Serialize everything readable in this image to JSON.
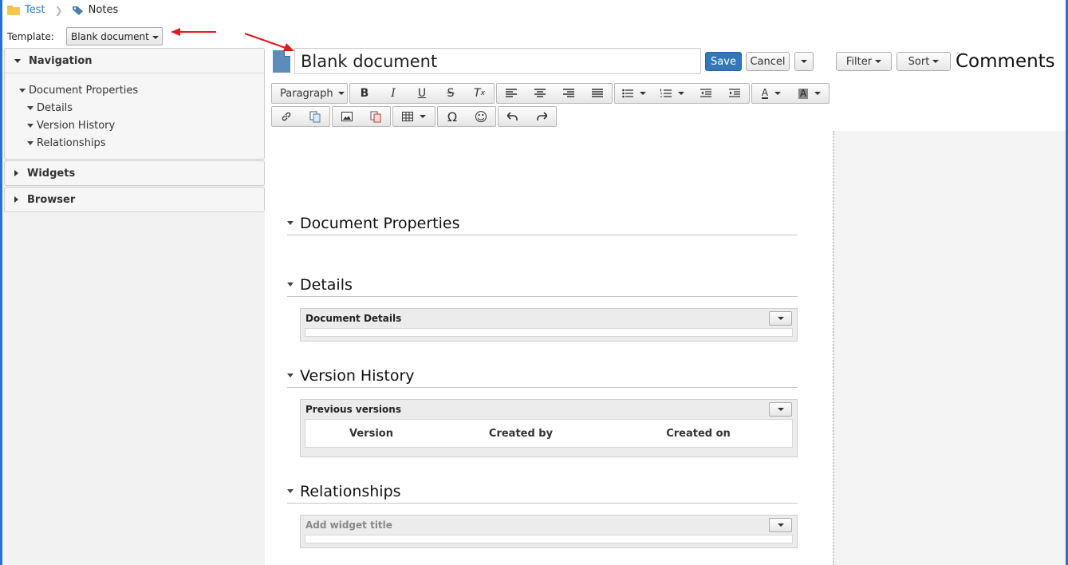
{
  "breadcrumb": {
    "parent": "Test",
    "current": "Notes"
  },
  "template": {
    "label": "Template:",
    "value": "Blank document"
  },
  "sidebar": {
    "navigation": {
      "title": "Navigation",
      "items": [
        {
          "label": "Document Properties"
        },
        {
          "label": "Details"
        },
        {
          "label": "Version History"
        },
        {
          "label": "Relationships"
        }
      ]
    },
    "widgets_title": "Widgets",
    "browser_title": "Browser"
  },
  "editor": {
    "title_value": "Blank document",
    "save_label": "Save",
    "cancel_label": "Cancel",
    "paragraph_label": "Paragraph"
  },
  "comments": {
    "filter_label": "Filter",
    "sort_label": "Sort",
    "title": "Comments"
  },
  "sections": {
    "document_properties": "Document Properties",
    "details": "Details",
    "version_history": "Version History",
    "relationships": "Relationships"
  },
  "widgets": {
    "document_details": "Document Details",
    "previous_versions": "Previous versions",
    "columns": [
      "Version",
      "Created by",
      "Created on"
    ],
    "add_widget_title": "Add widget title"
  },
  "colors": {
    "accent": "#3277b6",
    "annotation_arrow": "#e01b1b",
    "frame": "#2a6fd6"
  }
}
